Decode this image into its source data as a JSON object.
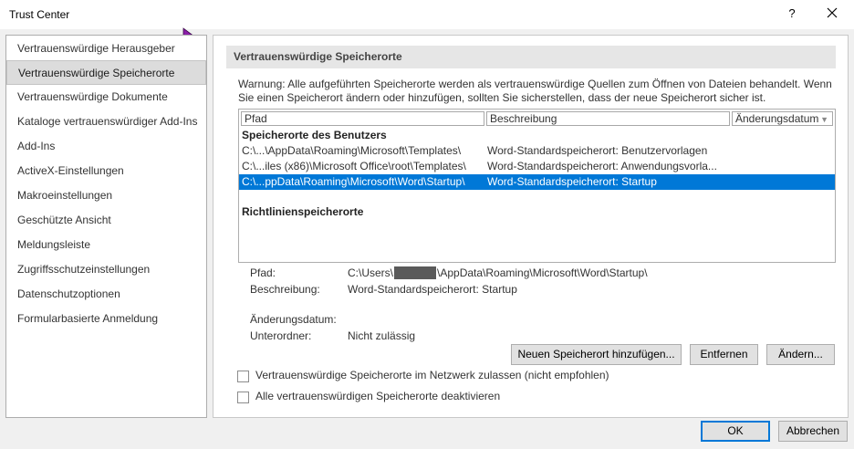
{
  "window": {
    "title": "Trust Center",
    "help_label": "?"
  },
  "sidebar": {
    "items": [
      {
        "label": "Vertrauenswürdige Herausgeber",
        "selected": false
      },
      {
        "label": "Vertrauenswürdige Speicherorte",
        "selected": true
      },
      {
        "label": "Vertrauenswürdige Dokumente",
        "selected": false
      },
      {
        "label": "Kataloge vertrauenswürdiger Add-Ins",
        "selected": false
      },
      {
        "label": "Add-Ins",
        "selected": false
      },
      {
        "label": "ActiveX-Einstellungen",
        "selected": false
      },
      {
        "label": "Makroeinstellungen",
        "selected": false
      },
      {
        "label": "Geschützte Ansicht",
        "selected": false
      },
      {
        "label": "Meldungsleiste",
        "selected": false
      },
      {
        "label": "Zugriffsschutzeinstellungen",
        "selected": false
      },
      {
        "label": "Datenschutzoptionen",
        "selected": false
      },
      {
        "label": "Formularbasierte Anmeldung",
        "selected": false
      }
    ]
  },
  "main": {
    "header": "Vertrauenswürdige Speicherorte",
    "warning_line1": "Warnung: Alle aufgeführten Speicherorte werden als vertrauenswürdige Quellen zum Öffnen von Dateien behandelt. Wenn",
    "warning_line2": "Sie einen Speicherort ändern oder hinzufügen, sollten Sie sicherstellen, dass der neue Speicherort sicher ist.",
    "table": {
      "columns": [
        "Pfad",
        "Beschreibung",
        "Änderungsdatum"
      ],
      "group_user": "Speicherorte des Benutzers",
      "rows": [
        {
          "path": "C:\\...\\AppData\\Roaming\\Microsoft\\Templates\\",
          "desc": "Word-Standardspeicherort: Benutzervorlagen",
          "selected": false
        },
        {
          "path": "C:\\...iles (x86)\\Microsoft Office\\root\\Templates\\",
          "desc": "Word-Standardspeicherort: Anwendungsvorla...",
          "selected": false
        },
        {
          "path": "C:\\...ppData\\Roaming\\Microsoft\\Word\\Startup\\",
          "desc": "Word-Standardspeicherort: Startup",
          "selected": true
        }
      ],
      "group_policy": "Richtlinienspeicherorte"
    },
    "details": {
      "path_label": "Pfad:",
      "path_prefix": "C:\\Users\\",
      "path_suffix": "\\AppData\\Roaming\\Microsoft\\Word\\Startup\\",
      "desc_label": "Beschreibung:",
      "desc_value": "Word-Standardspeicherort: Startup",
      "date_label": "Änderungsdatum:",
      "date_value": "",
      "sub_label": "Unterordner:",
      "sub_value": "Nicht zulässig"
    },
    "buttons": {
      "add": "Neuen Speicherort hinzufügen...",
      "remove": "Entfernen",
      "modify": "Ändern..."
    },
    "checkboxes": [
      {
        "label": "Vertrauenswürdige Speicherorte im Netzwerk zulassen (nicht empfohlen)",
        "checked": false
      },
      {
        "label": "Alle vertrauenswürdigen Speicherorte deaktivieren",
        "checked": false
      }
    ]
  },
  "footer": {
    "ok": "OK",
    "cancel": "Abbrechen"
  },
  "colors": {
    "selection": "#0078d7",
    "accent_cursor": "#8b1fa8"
  }
}
